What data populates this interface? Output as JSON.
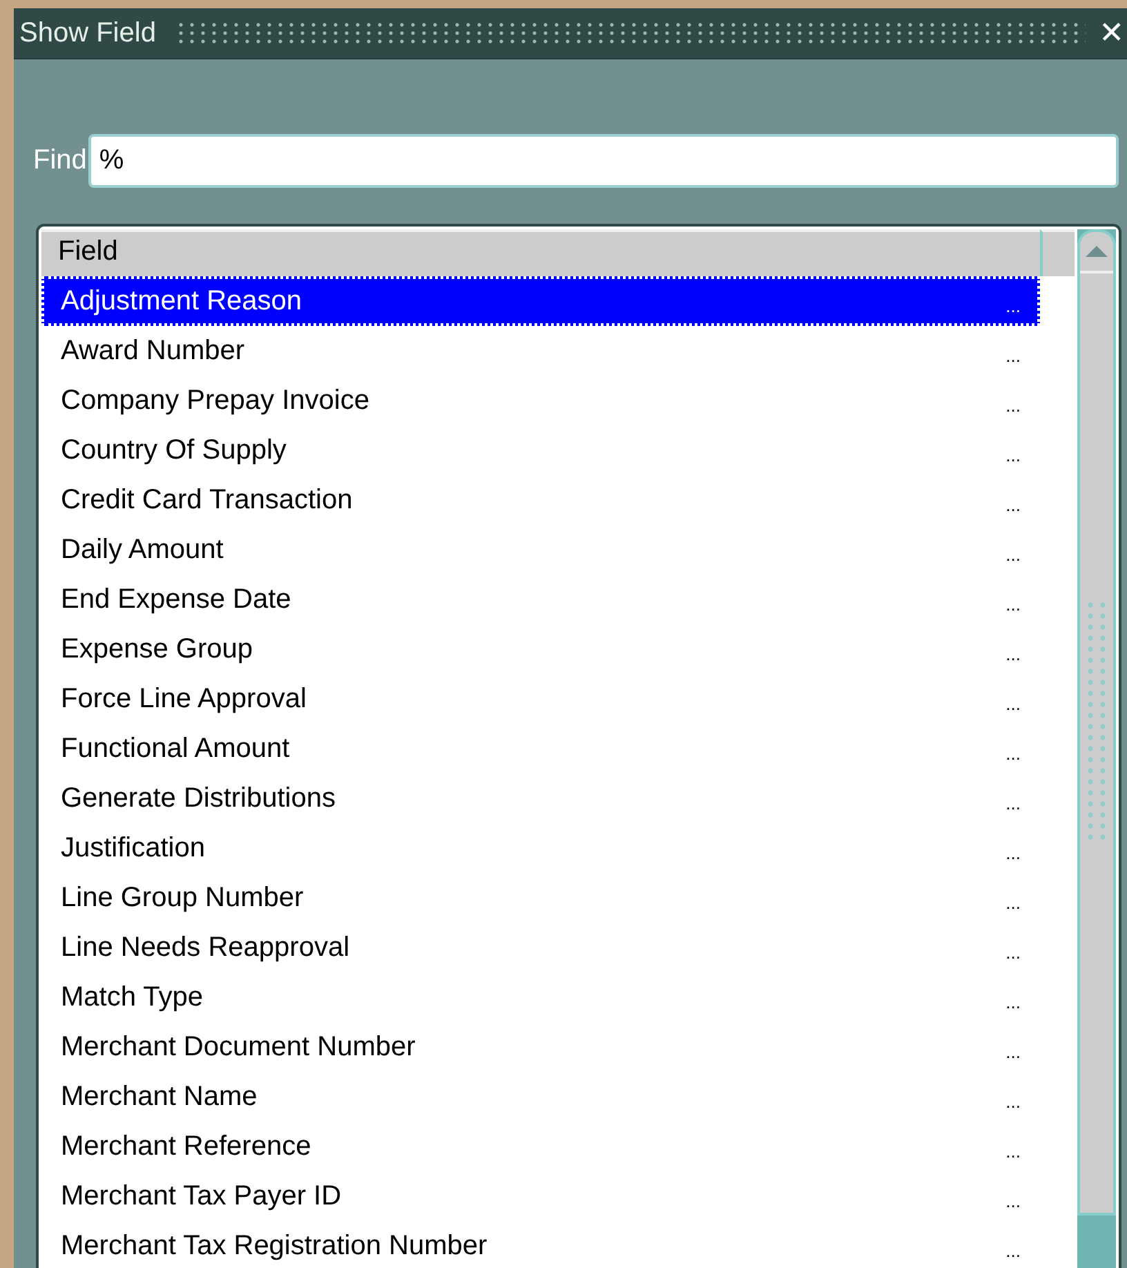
{
  "window": {
    "title": "Show Field",
    "close": "✕"
  },
  "find": {
    "label": "Find",
    "value": "%"
  },
  "list": {
    "columns": [
      {
        "label": "Field"
      }
    ],
    "rows": [
      {
        "field": "Adjustment Reason",
        "more": "...",
        "selected": true
      },
      {
        "field": "Award Number",
        "more": "...",
        "selected": false
      },
      {
        "field": "Company Prepay Invoice",
        "more": "...",
        "selected": false
      },
      {
        "field": "Country Of Supply",
        "more": "...",
        "selected": false
      },
      {
        "field": "Credit Card Transaction",
        "more": "...",
        "selected": false
      },
      {
        "field": "Daily Amount",
        "more": "...",
        "selected": false
      },
      {
        "field": "End Expense Date",
        "more": "...",
        "selected": false
      },
      {
        "field": "Expense Group",
        "more": "...",
        "selected": false
      },
      {
        "field": "Force Line Approval",
        "more": "...",
        "selected": false
      },
      {
        "field": "Functional Amount",
        "more": "...",
        "selected": false
      },
      {
        "field": "Generate Distributions",
        "more": "...",
        "selected": false
      },
      {
        "field": "Justification",
        "more": "...",
        "selected": false
      },
      {
        "field": "Line Group Number",
        "more": "...",
        "selected": false
      },
      {
        "field": "Line Needs Reapproval",
        "more": "...",
        "selected": false
      },
      {
        "field": "Match Type",
        "more": "...",
        "selected": false
      },
      {
        "field": "Merchant Document Number",
        "more": "...",
        "selected": false
      },
      {
        "field": "Merchant Name",
        "more": "...",
        "selected": false
      },
      {
        "field": "Merchant Reference",
        "more": "...",
        "selected": false
      },
      {
        "field": "Merchant Tax Payer ID",
        "more": "...",
        "selected": false
      },
      {
        "field": "Merchant Tax Registration Number",
        "more": "...",
        "selected": false
      }
    ]
  }
}
